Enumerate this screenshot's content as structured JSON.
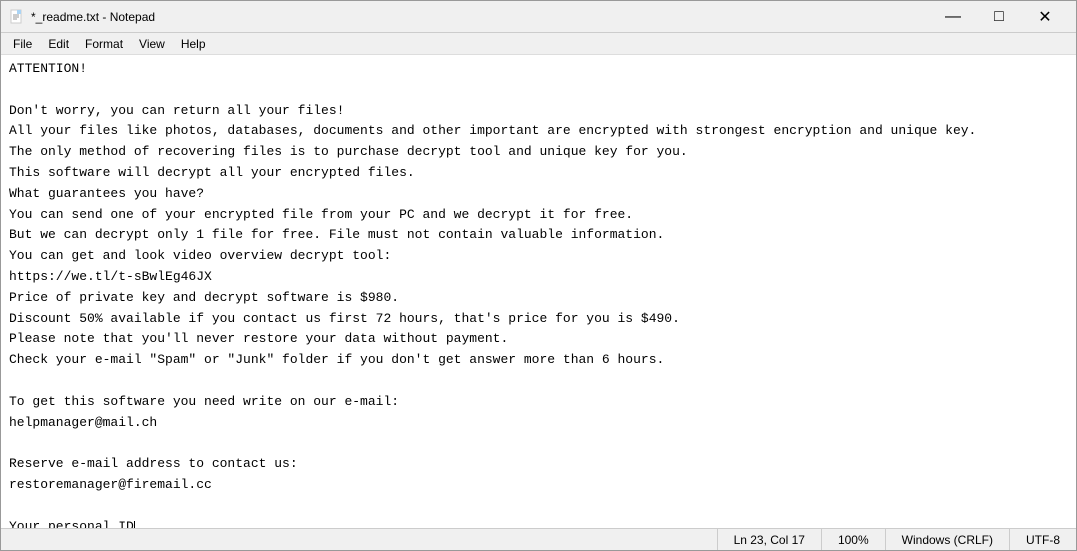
{
  "window": {
    "title": "*_readme.txt - Notepad",
    "icon": "📄"
  },
  "titlebar_controls": {
    "minimize": "—",
    "maximize": "□",
    "close": "✕"
  },
  "menu": {
    "items": [
      "File",
      "Edit",
      "Format",
      "View",
      "Help"
    ]
  },
  "editor": {
    "content_lines": [
      "ATTENTION!",
      "",
      "Don't worry, you can return all your files!",
      "All your files like photos, databases, documents and other important are encrypted with strongest encryption and unique key.",
      "The only method of recovering files is to purchase decrypt tool and unique key for you.",
      "This software will decrypt all your encrypted files.",
      "What guarantees you have?",
      "You can send one of your encrypted file from your PC and we decrypt it for free.",
      "But we can decrypt only 1 file for free. File must not contain valuable information.",
      "You can get and look video overview decrypt tool:",
      "https://we.tl/t-sBwlEg46JX",
      "Price of private key and decrypt software is $980.",
      "Discount 50% available if you contact us first 72 hours, that's price for you is $490.",
      "Please note that you'll never restore your data without payment.",
      "Check your e-mail \"Spam\" or \"Junk\" folder if you don't get answer more than 6 hours.",
      "",
      "To get this software you need write on our e-mail:",
      "helpmanager@mail.ch",
      "",
      "Reserve e-mail address to contact us:",
      "restoremanager@firemail.cc",
      "",
      "Your personal ID"
    ]
  },
  "status_bar": {
    "position": "Ln 23, Col 17",
    "zoom": "100%",
    "line_ending": "Windows (CRLF)",
    "encoding": "UTF-8"
  }
}
